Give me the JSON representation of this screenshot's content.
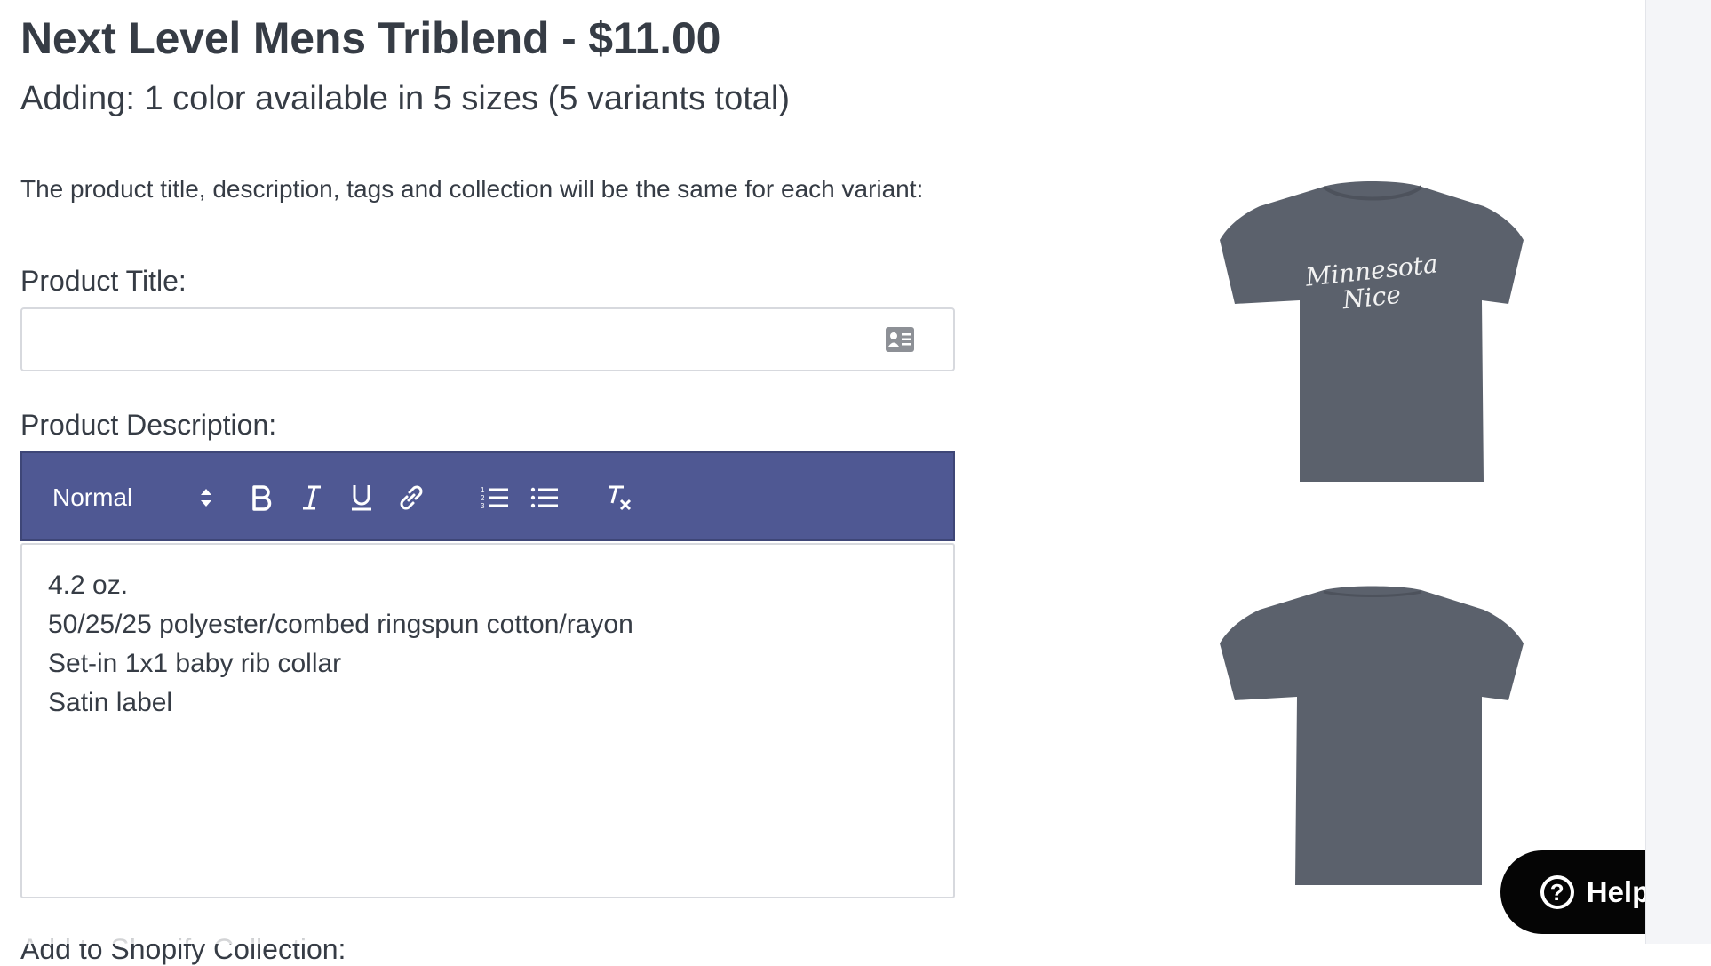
{
  "header": {
    "title": "Next Level Mens Triblend - $11.00",
    "subtitle": "Adding: 1 color available in 5 sizes (5 variants total)"
  },
  "intro_text": "The product title, description, tags and collection will be the same for each variant:",
  "product_title": {
    "label": "Product Title:",
    "value": "",
    "placeholder": "",
    "icon": "contact-card-icon"
  },
  "product_description": {
    "label": "Product Description:",
    "toolbar": {
      "format_value": "Normal",
      "buttons": [
        "bold-icon",
        "italic-icon",
        "underline-icon",
        "link-icon",
        "ordered-list-icon",
        "bullet-list-icon",
        "clear-format-icon"
      ]
    },
    "lines": [
      "4.2 oz.",
      "50/25/25 polyester/combed ringspun cotton/rayon",
      "Set-in 1x1 baby rib collar",
      "Satin label"
    ]
  },
  "collection": {
    "label": "Add to Shopify Collection:"
  },
  "preview": {
    "front_text": [
      "Minnesota",
      "Nice"
    ],
    "shirt_color": "#5b616c"
  },
  "help": {
    "label": "Help",
    "icon": "question-icon"
  },
  "colors": {
    "toolbar": "#4f5893",
    "text": "#363c45",
    "help_bg": "#050505"
  }
}
